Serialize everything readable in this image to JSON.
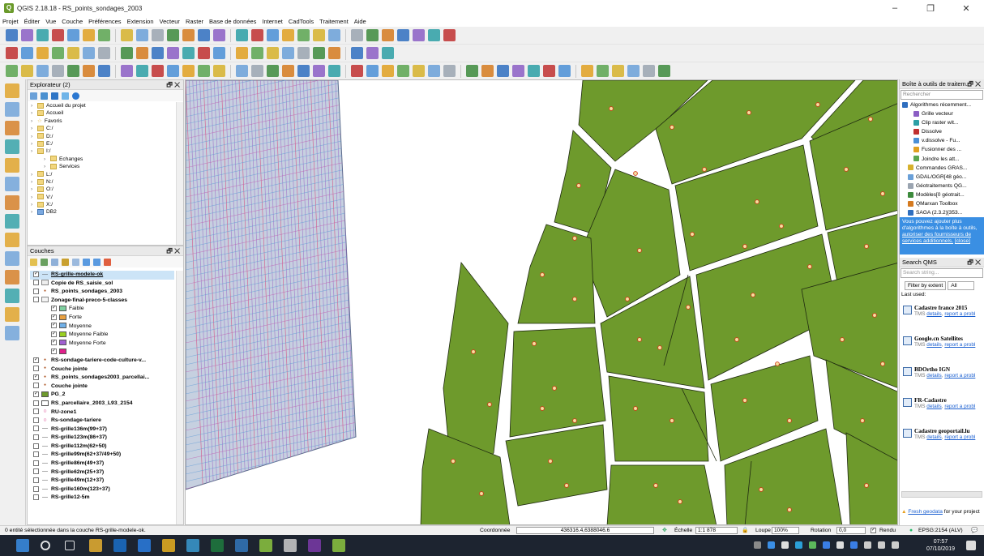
{
  "window": {
    "title": "QGIS 2.18.18 - RS_points_sondages_2003",
    "logo": "Q",
    "controls": [
      "–",
      "❐",
      "✕"
    ]
  },
  "menu": [
    "Projet",
    "Éditer",
    "Vue",
    "Couche",
    "Préférences",
    "Extension",
    "Vecteur",
    "Raster",
    "Base de données",
    "Internet",
    "CadTools",
    "Traitement",
    "Aide"
  ],
  "browser": {
    "title": "Explorateur (2)",
    "controls": "🗗 ✕",
    "items": [
      {
        "label": "Accueil du projet",
        "indent": 0,
        "type": "folder"
      },
      {
        "label": "Accueil",
        "indent": 0,
        "type": "folder"
      },
      {
        "label": "Favoris",
        "indent": 0,
        "type": "star"
      },
      {
        "label": "C:/",
        "indent": 0,
        "type": "folder"
      },
      {
        "label": "D:/",
        "indent": 0,
        "type": "folder"
      },
      {
        "label": "E:/",
        "indent": 0,
        "type": "folder"
      },
      {
        "label": "I:/",
        "indent": 0,
        "type": "folder"
      },
      {
        "label": "Echanges",
        "indent": 1,
        "type": "folder"
      },
      {
        "label": "Services",
        "indent": 1,
        "type": "folder"
      },
      {
        "label": "L:/",
        "indent": 0,
        "type": "folder"
      },
      {
        "label": "N:/",
        "indent": 0,
        "type": "folder"
      },
      {
        "label": "O:/",
        "indent": 0,
        "type": "folder"
      },
      {
        "label": "V:/",
        "indent": 0,
        "type": "folder"
      },
      {
        "label": "X:/",
        "indent": 0,
        "type": "folder"
      },
      {
        "label": "DB2",
        "indent": 0,
        "type": "db"
      }
    ]
  },
  "layers": {
    "title": "Couches",
    "controls": "🗗 ✕",
    "items": [
      {
        "label": "RS-grille-modele-ok",
        "check": "✓",
        "sym": "line",
        "bold": true,
        "indent": 0,
        "selected": true
      },
      {
        "label": "Copie de RS_saisie_sol",
        "check": "",
        "sym": "grid",
        "bold": true,
        "indent": 0
      },
      {
        "label": "RS_points_sondages_2003",
        "check": "",
        "sym": "dot",
        "bold": true,
        "indent": 0
      },
      {
        "label": "Zonage-final-preco-5-classes",
        "check": "",
        "sym": "poly",
        "bold": true,
        "indent": 0
      },
      {
        "label": "Faible",
        "check": "✓",
        "sym": "sw",
        "color": "#7fd0a0",
        "bold": false,
        "indent": 1
      },
      {
        "label": "Forte",
        "check": "✓",
        "sym": "sw",
        "color": "#e8a040",
        "bold": false,
        "indent": 1
      },
      {
        "label": "Moyenne",
        "check": "✓",
        "sym": "sw",
        "color": "#70b0e8",
        "bold": false,
        "indent": 1
      },
      {
        "label": "Moyenne Faible",
        "check": "✓",
        "sym": "sw",
        "color": "#9ad020",
        "bold": false,
        "indent": 1
      },
      {
        "label": "Moyenne Forte",
        "check": "✓",
        "sym": "sw",
        "color": "#a060d0",
        "bold": false,
        "indent": 1
      },
      {
        "label": "",
        "check": "✓",
        "sym": "sw",
        "color": "#e0208a",
        "bold": false,
        "indent": 1
      },
      {
        "label": "RS-sondage-tariere-code-culture-v...",
        "check": "✓",
        "sym": "dot",
        "bold": true,
        "indent": 0
      },
      {
        "label": "Couche jointe",
        "check": "",
        "sym": "dot",
        "bold": true,
        "indent": 0
      },
      {
        "label": "RS_points_sondages2003_parcellai...",
        "check": "✓",
        "sym": "dot",
        "bold": true,
        "indent": 0
      },
      {
        "label": "Couche jointe",
        "check": "",
        "sym": "dot",
        "bold": true,
        "indent": 0
      },
      {
        "label": "PG_2",
        "check": "✓",
        "sym": "sw",
        "color": "#6e9a2c",
        "bold": true,
        "indent": 0
      },
      {
        "label": "RS_parcellaire_2003_L93_2154",
        "check": "",
        "sym": "sw",
        "color": "#ffffff",
        "bold": true,
        "indent": 0
      },
      {
        "label": "RU-zone1",
        "check": "",
        "sym": "ring",
        "bold": true,
        "indent": 0
      },
      {
        "label": "Rs-sondage-tariere",
        "check": "",
        "sym": "ring",
        "bold": true,
        "indent": 0
      },
      {
        "label": "RS-grille136m(99+37)",
        "check": "",
        "sym": "line",
        "bold": true,
        "indent": 0
      },
      {
        "label": "RS-grille123m(86+37)",
        "check": "",
        "sym": "line",
        "bold": true,
        "indent": 0
      },
      {
        "label": "RS-grille112m(62+50)",
        "check": "",
        "sym": "line",
        "bold": true,
        "indent": 0
      },
      {
        "label": "RS-grille99m(62+37/49+50)",
        "check": "",
        "sym": "line",
        "bold": true,
        "indent": 0
      },
      {
        "label": "RS-grille86m(49+37)",
        "check": "",
        "sym": "line",
        "bold": true,
        "indent": 0
      },
      {
        "label": "RS-grille62m(25+37)",
        "check": "",
        "sym": "line",
        "bold": true,
        "indent": 0
      },
      {
        "label": "RS-grille49m(12+37)",
        "check": "",
        "sym": "line",
        "bold": true,
        "indent": 0
      },
      {
        "label": "RS-grille160m(123+37)",
        "check": "",
        "sym": "line",
        "bold": true,
        "indent": 0
      },
      {
        "label": "RS-grille12-5m",
        "check": "",
        "sym": "line",
        "bold": true,
        "indent": 0
      }
    ]
  },
  "toolbox": {
    "title": "Boîte à outils de traitem...",
    "controls": "🗗 ✕",
    "search_placeholder": "Rechercher",
    "items": [
      {
        "label": "Algorithmes récemment...",
        "indent": 0
      },
      {
        "label": "Grille vecteur",
        "indent": 2
      },
      {
        "label": "Clip raster wit...",
        "indent": 2
      },
      {
        "label": "Dissolve",
        "indent": 2
      },
      {
        "label": "v.dissolve - Fu...",
        "indent": 2
      },
      {
        "label": "Fusionner des ...",
        "indent": 2
      },
      {
        "label": "Joindre les att...",
        "indent": 2
      },
      {
        "label": "Commandes GRAS...",
        "indent": 1
      },
      {
        "label": "GDAL/OGR[48 géo...",
        "indent": 1
      },
      {
        "label": "Géotraitements QG...",
        "indent": 1
      },
      {
        "label": "Modèles[0 géotrait...",
        "indent": 1
      },
      {
        "label": "QMarxan Toolbox",
        "indent": 1
      },
      {
        "label": "SAGA (2.3.2)[353...",
        "indent": 1
      }
    ],
    "info_text": "Vous pouvez ajouter plus d'algorithmes à la boîte à outils,",
    "info_link": "autoriser des fournisseurs de services additionnels.",
    "info_close": "[close]"
  },
  "qms": {
    "title": "Search QMS",
    "controls": "🗗 ✕",
    "search_placeholder": "Search string...",
    "filter_label": "Filter by extent",
    "filter_value": "All",
    "last_used": "Last used:",
    "services": [
      {
        "name": "Cadastre france 2015"
      },
      {
        "name": "Google.cn Satellites"
      },
      {
        "name": "BDOrtho IGN"
      },
      {
        "name": "FR-Cadastre"
      },
      {
        "name": "Cadastre geoportail.lu"
      }
    ],
    "tms_prefix": "TMS",
    "details_link": "details",
    "report_link": "report a probl",
    "fresh_link": "Fresh geodata",
    "fresh_text": "for your project"
  },
  "status": {
    "message": "0 entité sélectionnée dans la couche RS-grille-modele-ok.",
    "coord_label": "Coordonnée",
    "coord_value": "436316.4,6388046.6",
    "scale_label": "Échelle",
    "scale_value": "1:1 878",
    "loupe_label": "Loupe",
    "loupe_value": "100%",
    "rotation_label": "Rotation",
    "rotation_value": "0,0",
    "render_label": "Rendu",
    "crs": "EPSG:2154 (ALV)"
  },
  "taskbar": {
    "time": "07:57",
    "date": "07/10/2019"
  },
  "colors": {
    "parcel": "#6e9a2c",
    "parcel_edge": "#1f2a10",
    "point_fill": "#f6e0a0",
    "point_edge": "#d23b1a",
    "grid_bg": "#c6d0e0",
    "grid_line": "#9d6bc6"
  }
}
